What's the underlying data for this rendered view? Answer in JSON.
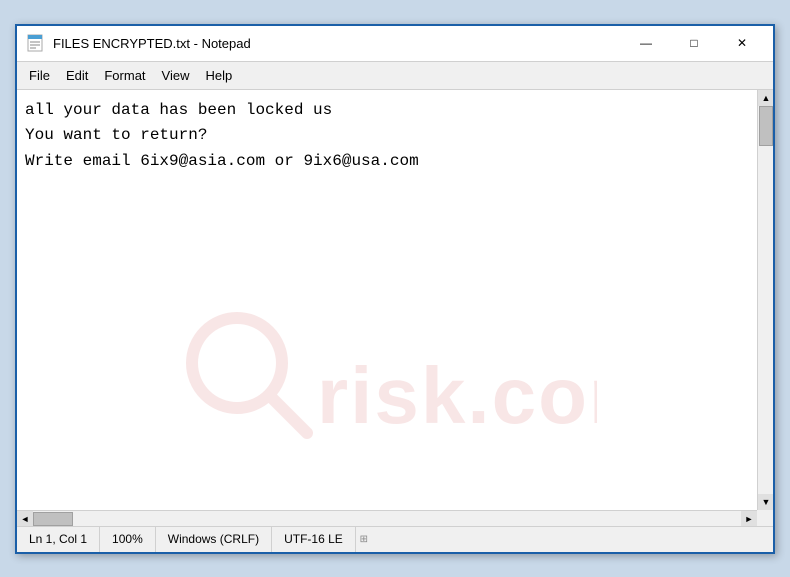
{
  "window": {
    "title": "FILES ENCRYPTED.txt - Notepad",
    "icon": "notepad"
  },
  "titlebar": {
    "minimize_label": "—",
    "maximize_label": "□",
    "close_label": "✕"
  },
  "menu": {
    "items": [
      {
        "label": "File"
      },
      {
        "label": "Edit"
      },
      {
        "label": "Format"
      },
      {
        "label": "View"
      },
      {
        "label": "Help"
      }
    ]
  },
  "editor": {
    "content": "all your data has been locked us\nYou want to return?\nWrite email 6ix9@asia.com or 9ix6@usa.com"
  },
  "statusbar": {
    "position": "Ln 1, Col 1",
    "zoom": "100%",
    "line_ending": "Windows (CRLF)",
    "encoding": "UTF-16 LE"
  },
  "watermark": {
    "text": "risk.com"
  }
}
